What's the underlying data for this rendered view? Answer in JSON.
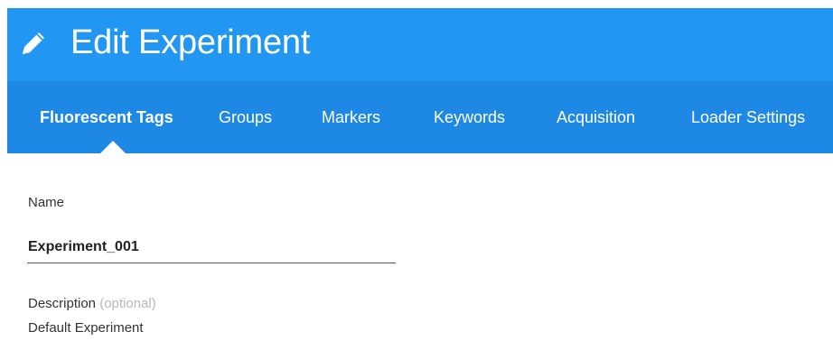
{
  "header": {
    "title": "Edit Experiment",
    "icon": "pencil-icon",
    "background_color": "#2196f3"
  },
  "tabs": {
    "background_color": "#1e88e5",
    "items": [
      {
        "label": "Fluorescent Tags",
        "active": true
      },
      {
        "label": "Groups",
        "active": false
      },
      {
        "label": "Markers",
        "active": false
      },
      {
        "label": "Keywords",
        "active": false
      },
      {
        "label": "Acquisition",
        "active": false
      },
      {
        "label": "Loader Settings",
        "active": false
      }
    ]
  },
  "form": {
    "name_label": "Name",
    "name_value": "Experiment_001",
    "description_label": "Description",
    "description_optional": "(optional)",
    "description_value": "Default Experiment"
  }
}
